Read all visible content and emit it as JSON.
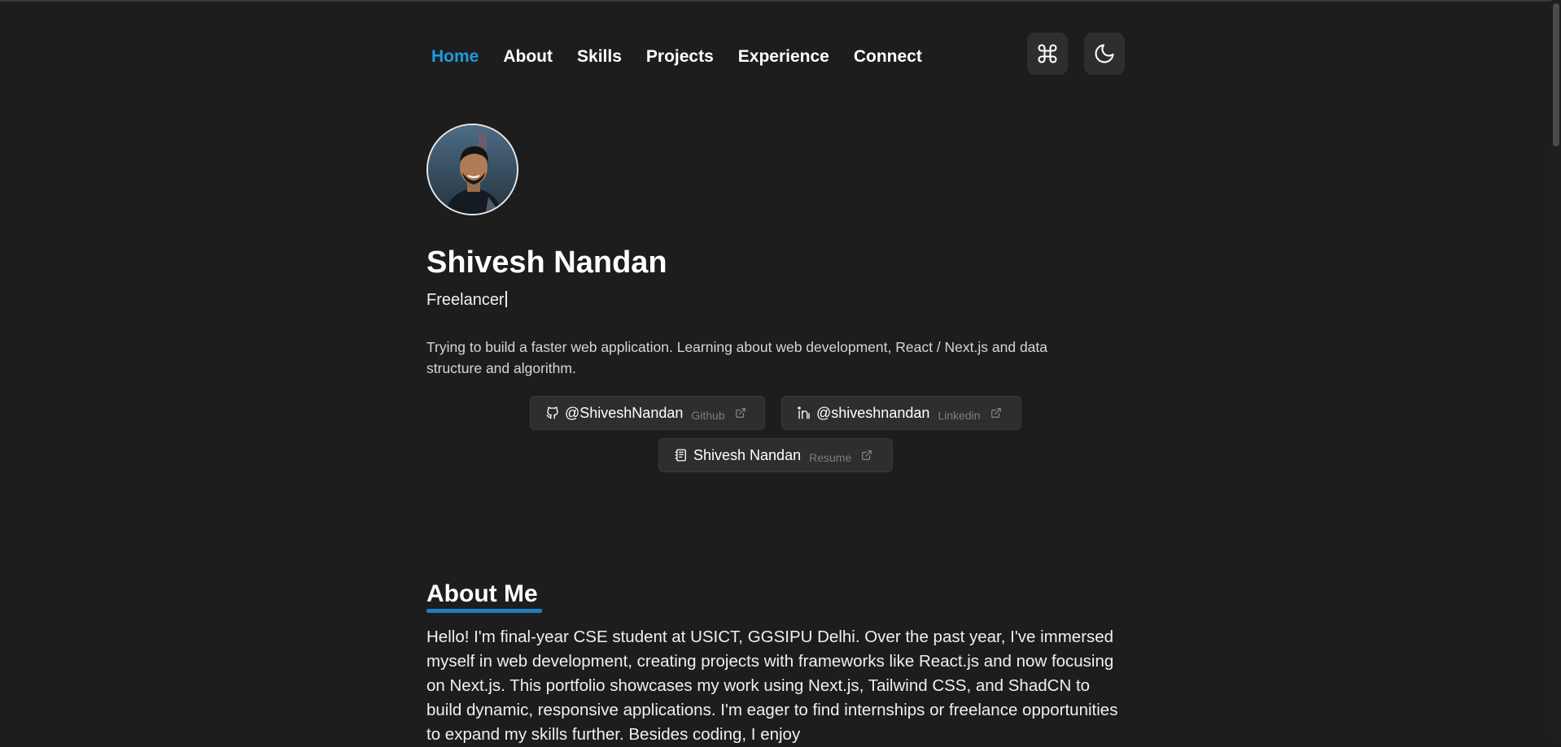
{
  "nav": {
    "items": [
      {
        "label": "Home",
        "active": true
      },
      {
        "label": "About",
        "active": false
      },
      {
        "label": "Skills",
        "active": false
      },
      {
        "label": "Projects",
        "active": false
      },
      {
        "label": "Experience",
        "active": false
      },
      {
        "label": "Connect",
        "active": false
      }
    ],
    "command_icon": "command-icon",
    "theme_icon": "moon-icon"
  },
  "profile": {
    "name": "Shivesh Nandan",
    "role": "Freelancer",
    "bio": "Trying to build a faster web application. Learning about web development, React / Next.js and data structure and algorithm."
  },
  "links": {
    "github": {
      "handle": "@ShiveshNandan",
      "platform": "Github",
      "icon": "github-icon"
    },
    "linkedin": {
      "handle": "@shiveshnandan",
      "platform": "Linkedin",
      "icon": "linkedin-icon"
    },
    "resume": {
      "handle": "Shivesh Nandan",
      "platform": "Resume",
      "icon": "document-icon"
    }
  },
  "about": {
    "title": "About Me",
    "text": "Hello! I'm final-year CSE student at USICT, GGSIPU Delhi. Over the past year, I've immersed myself in web development, creating projects with frameworks like React.js and now focusing on Next.js. This portfolio showcases my work using Next.js, Tailwind CSS, and ShadCN to build dynamic, responsive applications. I'm eager to find internships or freelance opportunities to expand my skills further. Besides coding, I enjoy"
  },
  "colors": {
    "background": "#1d1d1d",
    "accent": "#1e9be0",
    "chip": "#2e2e2e"
  }
}
